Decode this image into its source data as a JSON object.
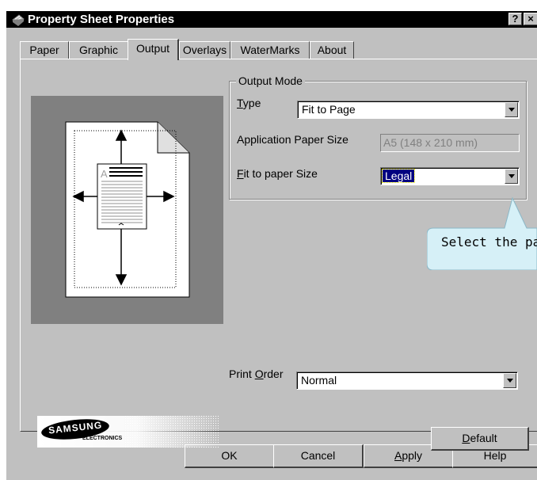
{
  "window": {
    "title": "Property Sheet Properties",
    "help_button": "?",
    "close_button": "×"
  },
  "tabs": [
    {
      "label": "Paper"
    },
    {
      "label": "Graphic"
    },
    {
      "label": "Output"
    },
    {
      "label": "Overlays"
    },
    {
      "label": "WaterMarks"
    },
    {
      "label": "About"
    }
  ],
  "active_tab": "Output",
  "output_mode": {
    "legend": "Output Mode",
    "type_label": "Type",
    "type_value": "Fit to Page",
    "app_paper_size_label": "Application Paper Size",
    "app_paper_size_value": "A5 (148 x 210 mm)",
    "fit_paper_size_label": "Fit to paper Size",
    "fit_paper_size_value": "Legal"
  },
  "print_order": {
    "label": "Print Order",
    "value": "Normal"
  },
  "logo": {
    "brand": "SAMSUNG",
    "sub": "ELECTRONICS"
  },
  "buttons": {
    "default": "Default",
    "ok": "OK",
    "cancel": "Cancel",
    "apply": "Apply",
    "help": "Help"
  },
  "tooltip": {
    "text": "Select the pa"
  },
  "preview": {
    "page_letter": "A"
  },
  "colors": {
    "title_bar": "#000000",
    "dialog_face": "#c0c0c0",
    "preview_bg": "#808080",
    "selection": "#000080",
    "tooltip_bg": "#d6f0f7"
  }
}
